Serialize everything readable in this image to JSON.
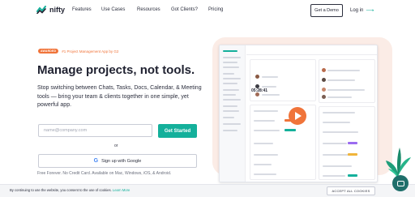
{
  "brand": {
    "name": "nifty",
    "accent": "#14b09b",
    "orange": "#f0743a"
  },
  "nav": {
    "links": [
      "Features",
      "Use Cases",
      "Resources",
      "Got Clients?",
      "Pricing"
    ],
    "demo_label": "Get a Demo",
    "login_label": "Log in",
    "login_arrow": "⟶"
  },
  "hero": {
    "badge": "AWARDED",
    "badge_text": "#1 Project Management App by G2",
    "headline": "Manage projects, not tools.",
    "subheadline": "Stop switching between Chats, Tasks, Docs, Calendar, & Meeting tools — bring your team & clients together in one simple, yet powerful app.",
    "email_placeholder": "name@company.com",
    "cta_label": "Get Started",
    "or_label": "or",
    "google_label": "Sign up with Google",
    "google_icon": "G",
    "fine_print": "Free Forever. No Credit Card. Available on Mac, Windows, iOS, & Android."
  },
  "preview": {
    "timer": "05:28:41",
    "play_icon": "play-icon"
  },
  "cookie": {
    "text": "By continuing to use the website, you consent to the use of cookies.",
    "link": "Learn More",
    "accept_label": "ACCEPT ALL COOKIES"
  }
}
